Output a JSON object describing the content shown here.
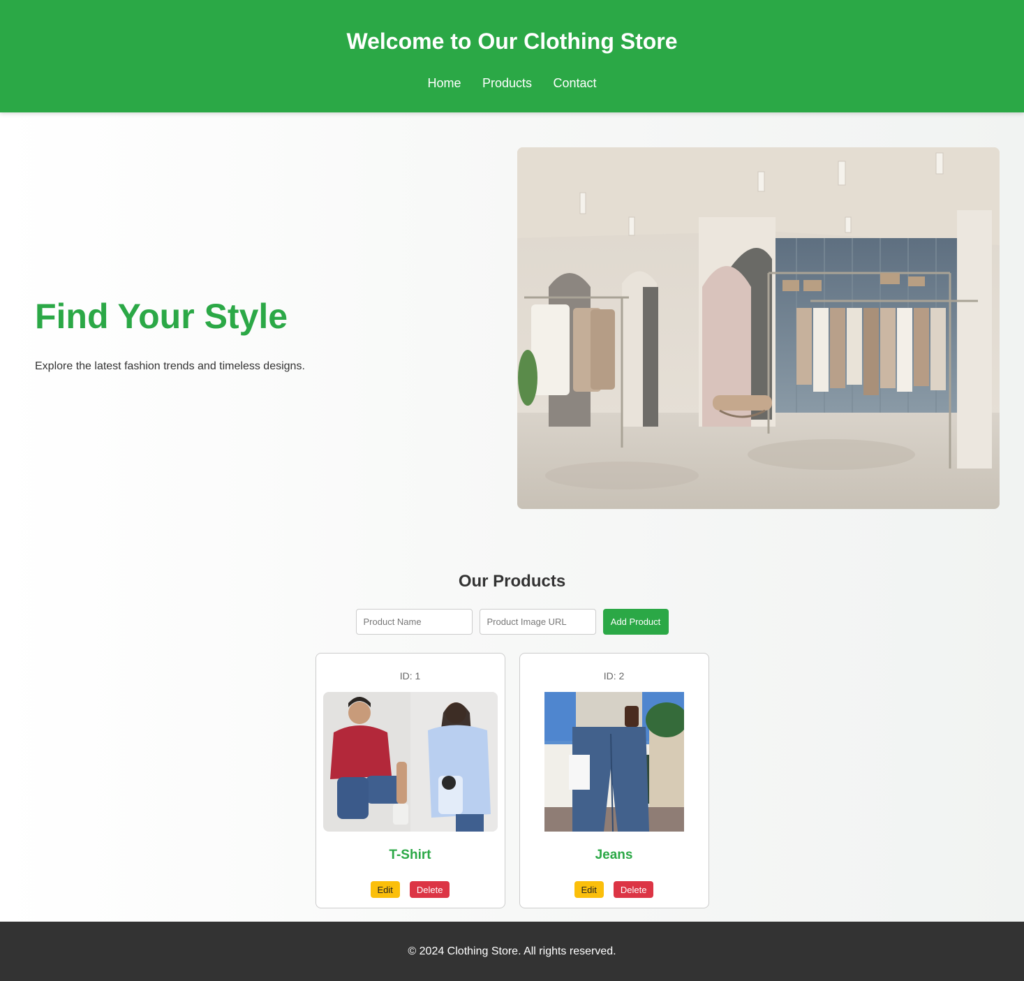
{
  "header": {
    "title": "Welcome to Our Clothing Store",
    "nav": [
      "Home",
      "Products",
      "Contact"
    ]
  },
  "hero": {
    "heading": "Find Your Style",
    "subtitle": "Explore the latest fashion trends and timeless designs."
  },
  "products": {
    "heading": "Our Products",
    "form": {
      "name_placeholder": "Product Name",
      "url_placeholder": "Product Image URL",
      "add_label": "Add Product"
    },
    "items": [
      {
        "id_label": "ID: 1",
        "name": "T-Shirt",
        "edit_label": "Edit",
        "delete_label": "Delete"
      },
      {
        "id_label": "ID: 2",
        "name": "Jeans",
        "edit_label": "Edit",
        "delete_label": "Delete"
      }
    ]
  },
  "footer": {
    "text": "© 2024 Clothing Store. All rights reserved."
  },
  "colors": {
    "brand_green": "#2ba846",
    "edit_yellow": "#fbbf0b",
    "delete_red": "#dc3545",
    "footer_bg": "#333333"
  }
}
